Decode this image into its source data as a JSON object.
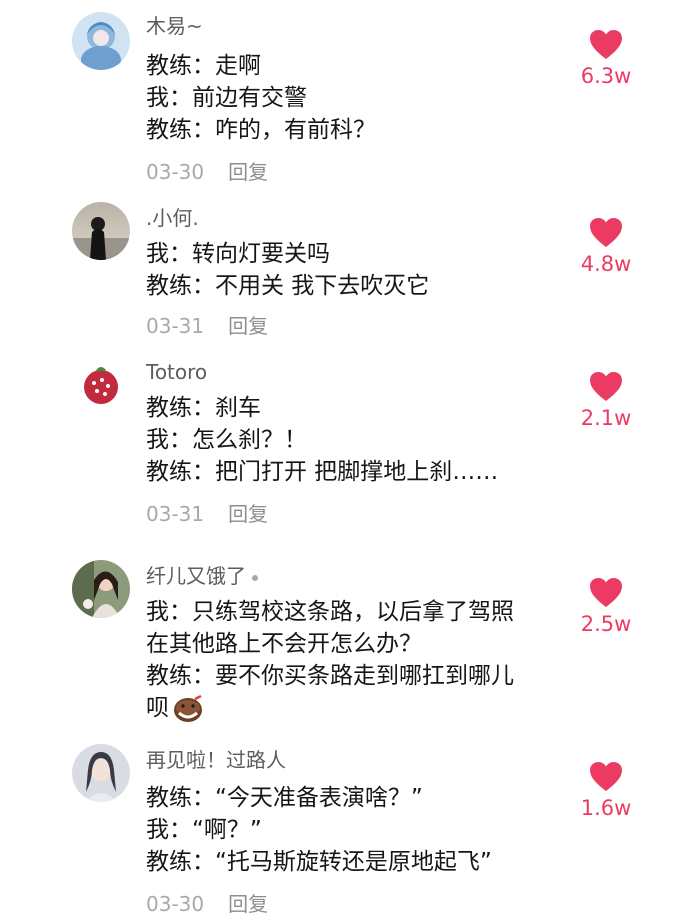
{
  "accent_color": "#ec3b62",
  "comments": [
    {
      "username": "木易~",
      "lines": [
        "教练：走啊",
        "我：前边有交警",
        "教练：咋的，有前科？"
      ],
      "date": "03-30",
      "reply": "回复",
      "likes": "6.3w"
    },
    {
      "username": ".小何.",
      "lines": [
        "我：转向灯要关吗",
        "教练：不用关 我下去吹灭它"
      ],
      "date": "03-31",
      "reply": "回复",
      "likes": "4.8w"
    },
    {
      "username": "Totoro",
      "lines": [
        "教练：刹车",
        "我：怎么刹？！",
        "教练：把门打开 把脚撑地上刹……"
      ],
      "date": "03-31",
      "reply": "回复",
      "likes": "2.1w"
    },
    {
      "username": "纤儿又饿了",
      "lines": [
        "我：只练驾校这条路，以后拿了驾照",
        "在其他路上不会开怎么办？",
        "教练：要不你买条路走到哪扛到哪儿",
        "呗"
      ],
      "likes": "2.5w"
    },
    {
      "username": "再见啦！过路人",
      "lines": [
        "教练：“今天准备表演啥？”",
        "我：“啊？”",
        "教练：“托马斯旋转还是原地起飞”"
      ],
      "date": "03-30",
      "reply": "回复",
      "likes": "1.6w"
    }
  ]
}
